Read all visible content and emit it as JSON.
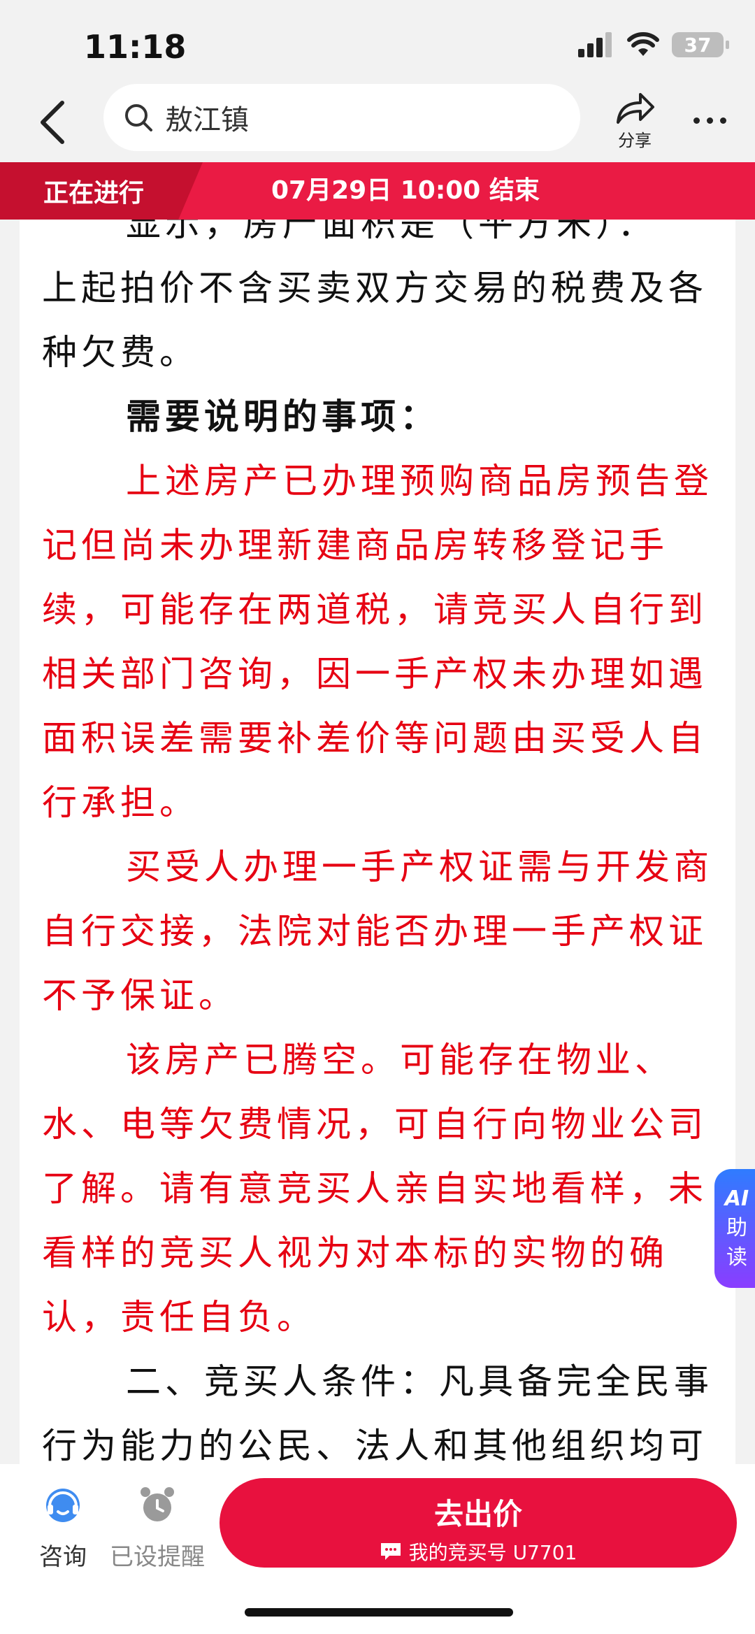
{
  "status_bar": {
    "time": "11:18",
    "battery": "37"
  },
  "nav": {
    "search_text": "敖江镇",
    "share_label": "分享"
  },
  "banner": {
    "tag": "正在进行",
    "end_text": "07月29日 10:00 结束"
  },
  "content": {
    "partial_top": "显示，房产面积是（平方米）：",
    "p1": "上起拍价不含买卖双方交易的税费及各种欠费。",
    "heading": "需要说明的事项：",
    "red1": "上述房产已办理预购商品房预告登记但尚未办理新建商品房转移登记手续，可能存在两道税，请竞买人自行到相关部门咨询，因一手产权未办理如遇面积误差需要补差价等问题由买受人自行承担。",
    "red2": "买受人办理一手产权证需与开发商自行交接，法院对能否办理一手产权证不予保证。",
    "red3": "该房产已腾空。可能存在物业、水、电等欠费情况，可自行向物业公司了解。请有意竞买人亲自实地看样，未看样的竞买人视为对本标的实物的确认，责任自负。",
    "p2": "二、竞买人条件：凡具备完全民事行为能力的公民、法人和其他组织均可参加竞买。"
  },
  "ai_badge": {
    "line1": "AI",
    "line2": "助",
    "line3": "读"
  },
  "bottom": {
    "consult_label": "咨询",
    "remind_label": "已设提醒",
    "bid_label": "去出价",
    "bid_number": "我的竞买号 U7701"
  },
  "colors": {
    "accent": "#ea1b44",
    "text_red": "#e60012"
  },
  "icons": [
    "back-arrow-icon",
    "search-icon",
    "share-icon",
    "more-icon",
    "consult-icon",
    "alarm-clock-icon",
    "chat-icon"
  ]
}
